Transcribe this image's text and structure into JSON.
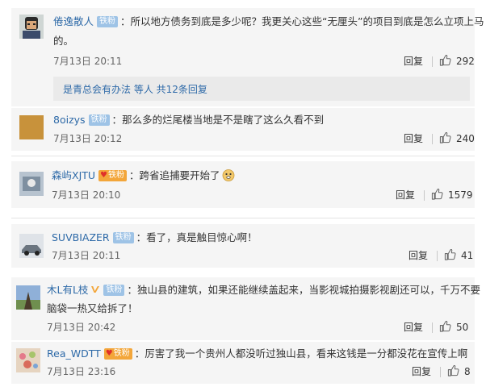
{
  "comments": [
    {
      "user": "倦逸散人",
      "badge": "铁粉",
      "text_line1": "所以地方债务到底是多少呢？我更关心这些“无厘头”的项目到底是怎么立项上马",
      "text_line2": "的。",
      "time": "7月13日 20:11",
      "reply_label": "回复",
      "likes": "292",
      "sub_replies": {
        "user": "是青总会有办法",
        "text": "等人 共12条回复"
      }
    },
    {
      "user": "8oizys",
      "badge": "铁粉",
      "text_line1": "那么多的烂尾楼当地是不是瞎了这么久看不到",
      "time": "7月13日 20:12",
      "reply_label": "回复",
      "likes": "240"
    },
    {
      "user": "森屿XJTU",
      "badge": "铁粉",
      "text_line1": "跨省追捕要开始了",
      "emoji": "doge-emoji",
      "time": "7月13日 20:10",
      "reply_label": "回复",
      "likes": "1579"
    },
    {
      "user": "SUVBIAZER",
      "badge": "铁粉",
      "text_line1": "看了，真是触目惊心啊！",
      "time": "7月13日 20:11",
      "reply_label": "回复",
      "likes": "41"
    },
    {
      "user": "木L有L枝",
      "badge": "铁粉",
      "text_line1": "独山县的建筑，如果还能继续盖起来，当影视城拍摄影视剧还可以，千万不要",
      "text_line2": "脑袋一热又给拆了！",
      "time": "7月13日 20:42",
      "reply_label": "回复",
      "likes": "50"
    },
    {
      "user": "Rea_WDTT",
      "badge": "铁粉",
      "text_line1": "厉害了我一个贵州人都没听过独山县，看来这钱是一分都没花在宣传上啊",
      "time": "7月13日 23:16",
      "reply_label": "回复",
      "likes": "8"
    }
  ],
  "colors": {
    "username": "#2e6aa8",
    "badge_blue": "#9ec3e6",
    "badge_gold": "#f3a63a",
    "card_bg": "#f5f5f5"
  },
  "icons": {
    "like": "thumbs-up-icon",
    "verified": "v-verified-icon",
    "fan_heart": "heart-icon"
  }
}
